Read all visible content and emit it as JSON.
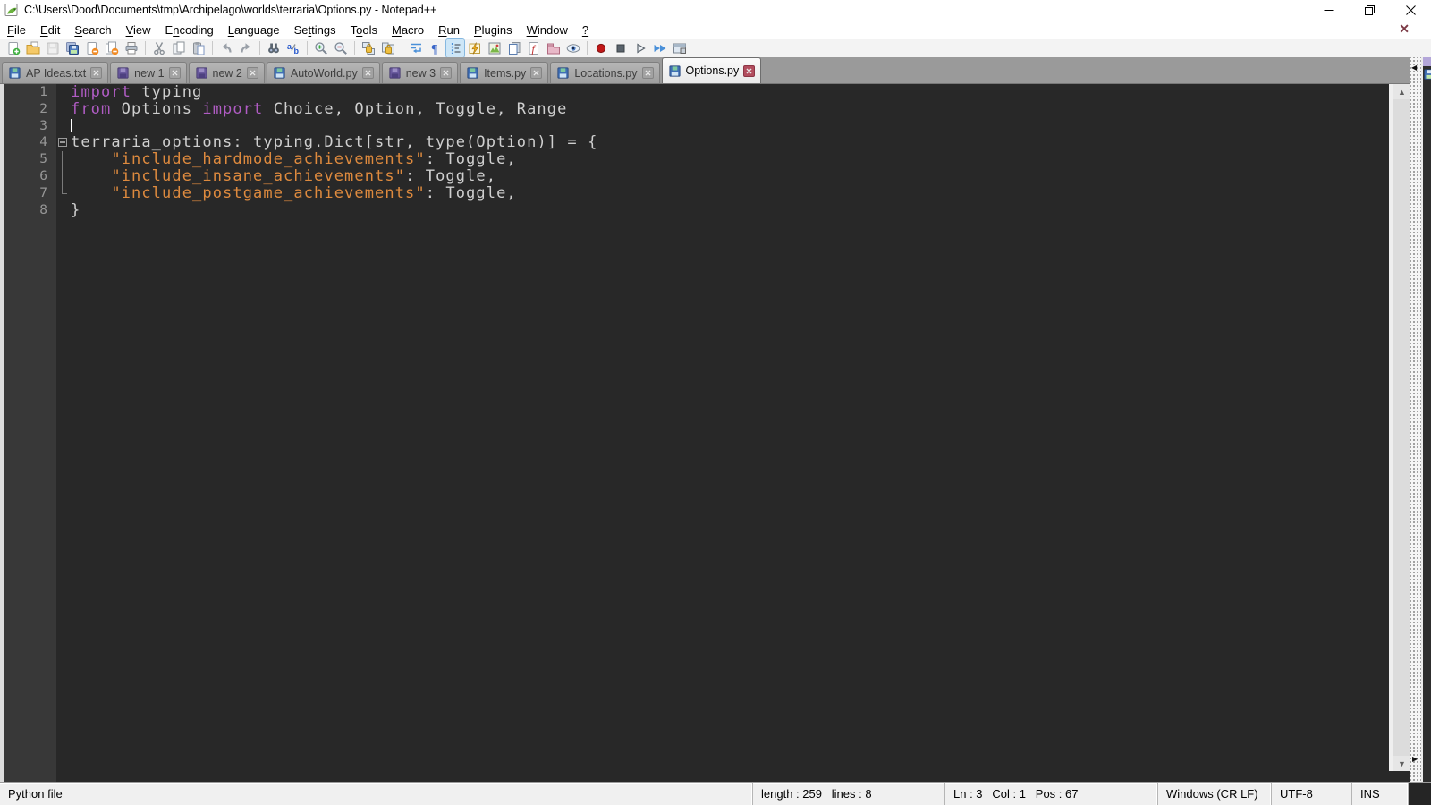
{
  "window": {
    "title": "C:\\Users\\Dood\\Documents\\tmp\\Archipelago\\worlds\\terraria\\Options.py - Notepad++",
    "controls": [
      "minimize",
      "restore",
      "close"
    ]
  },
  "menu": {
    "items": [
      {
        "name": "file",
        "pre": "",
        "key": "F",
        "post": "ile"
      },
      {
        "name": "edit",
        "pre": "",
        "key": "E",
        "post": "dit"
      },
      {
        "name": "search",
        "pre": "",
        "key": "S",
        "post": "earch"
      },
      {
        "name": "view",
        "pre": "",
        "key": "V",
        "post": "iew"
      },
      {
        "name": "encoding",
        "pre": "E",
        "key": "n",
        "post": "coding"
      },
      {
        "name": "language",
        "pre": "",
        "key": "L",
        "post": "anguage"
      },
      {
        "name": "settings",
        "pre": "Se",
        "key": "t",
        "post": "tings"
      },
      {
        "name": "tools",
        "pre": "T",
        "key": "o",
        "post": "ols"
      },
      {
        "name": "macro",
        "pre": "",
        "key": "M",
        "post": "acro"
      },
      {
        "name": "run",
        "pre": "",
        "key": "R",
        "post": "un"
      },
      {
        "name": "plugins",
        "pre": "",
        "key": "P",
        "post": "lugins"
      },
      {
        "name": "window",
        "pre": "",
        "key": "W",
        "post": "indow"
      },
      {
        "name": "help",
        "pre": "",
        "key": "?",
        "post": ""
      }
    ],
    "doc_close_x": "✕"
  },
  "toolbar": {
    "items": [
      {
        "name": "new-file"
      },
      {
        "name": "open-file"
      },
      {
        "name": "save-file",
        "disabled": true
      },
      {
        "name": "save-all"
      },
      {
        "name": "close-file"
      },
      {
        "name": "close-all"
      },
      {
        "name": "print"
      },
      {
        "name": "cut",
        "sep": true
      },
      {
        "name": "copy"
      },
      {
        "name": "paste"
      },
      {
        "name": "undo",
        "sep": true
      },
      {
        "name": "redo"
      },
      {
        "name": "find",
        "sep": true
      },
      {
        "name": "replace"
      },
      {
        "name": "zoom-in",
        "sep": true
      },
      {
        "name": "zoom-out"
      },
      {
        "name": "sync-vertical",
        "sep": true
      },
      {
        "name": "sync-horizontal"
      },
      {
        "name": "word-wrap",
        "sep": true
      },
      {
        "name": "show-all-characters"
      },
      {
        "name": "show-indent-guide",
        "active": true
      },
      {
        "name": "user-defined-language"
      },
      {
        "name": "document-map"
      },
      {
        "name": "document-list"
      },
      {
        "name": "function-list"
      },
      {
        "name": "folder-as-workspace"
      },
      {
        "name": "monitoring"
      },
      {
        "name": "macro-record",
        "sep": true
      },
      {
        "name": "macro-stop"
      },
      {
        "name": "macro-play"
      },
      {
        "name": "macro-run-multiple"
      },
      {
        "name": "macro-save"
      }
    ]
  },
  "tabs": [
    {
      "label": "AP Ideas.txt",
      "state": "saved",
      "active": false
    },
    {
      "label": "new 1",
      "state": "modified",
      "active": false
    },
    {
      "label": "new 2",
      "state": "modified",
      "active": false
    },
    {
      "label": "AutoWorld.py",
      "state": "saved",
      "active": false
    },
    {
      "label": "new 3",
      "state": "modified",
      "active": false
    },
    {
      "label": "Items.py",
      "state": "saved",
      "active": false
    },
    {
      "label": "Locations.py",
      "state": "saved",
      "active": false
    },
    {
      "label": "Options.py",
      "state": "saved",
      "active": true
    }
  ],
  "editor": {
    "lines": [
      {
        "n": "1",
        "fold": "",
        "tokens": [
          {
            "c": "kw",
            "t": "import"
          },
          {
            "c": "d",
            "t": " typing"
          }
        ]
      },
      {
        "n": "2",
        "fold": "",
        "tokens": [
          {
            "c": "kw",
            "t": "from"
          },
          {
            "c": "d",
            "t": " Options "
          },
          {
            "c": "kw",
            "t": "import"
          },
          {
            "c": "d",
            "t": " Choice, Option, Toggle, Range"
          }
        ]
      },
      {
        "n": "3",
        "fold": "",
        "cursor": true,
        "tokens": []
      },
      {
        "n": "4",
        "fold": "open",
        "tokens": [
          {
            "c": "d",
            "t": "terraria_options: typing.Dict[str, type(Option)] = {"
          }
        ]
      },
      {
        "n": "5",
        "fold": "line",
        "tokens": [
          {
            "c": "d",
            "t": "    "
          },
          {
            "c": "str",
            "t": "\"include_hardmode_achievements\""
          },
          {
            "c": "d",
            "t": ": Toggle,"
          }
        ]
      },
      {
        "n": "6",
        "fold": "line",
        "tokens": [
          {
            "c": "d",
            "t": "    "
          },
          {
            "c": "str",
            "t": "\"include_insane_achievements\""
          },
          {
            "c": "d",
            "t": ": Toggle,"
          }
        ]
      },
      {
        "n": "7",
        "fold": "end",
        "tokens": [
          {
            "c": "d",
            "t": "    "
          },
          {
            "c": "str",
            "t": "\"include_postgame_achievements\""
          },
          {
            "c": "d",
            "t": ": Toggle,"
          }
        ]
      },
      {
        "n": "8",
        "fold": "",
        "tokens": [
          {
            "c": "d",
            "t": "}"
          }
        ]
      }
    ]
  },
  "statusbar": {
    "cells": [
      {
        "name": "doc-type",
        "text": "Python file"
      },
      {
        "name": "length-lines",
        "text": "length : 259   lines : 8"
      },
      {
        "name": "cursor-position",
        "text": "Ln : 3   Col : 1   Pos : 67"
      },
      {
        "name": "eol-format",
        "text": "Windows (CR LF)"
      },
      {
        "name": "encoding",
        "text": "UTF-8"
      },
      {
        "name": "insert-mode",
        "text": "INS"
      }
    ]
  },
  "colors": {
    "editor_background": "#282828",
    "gutter_background": "#383838",
    "keyword": "#b05cc4",
    "string": "#de8a3e",
    "default_text": "#cfcfcf",
    "active_tab_close": "#b24d5e",
    "modified_floppy": "#6a5a9e",
    "saved_floppy": "#3f6fb5"
  }
}
